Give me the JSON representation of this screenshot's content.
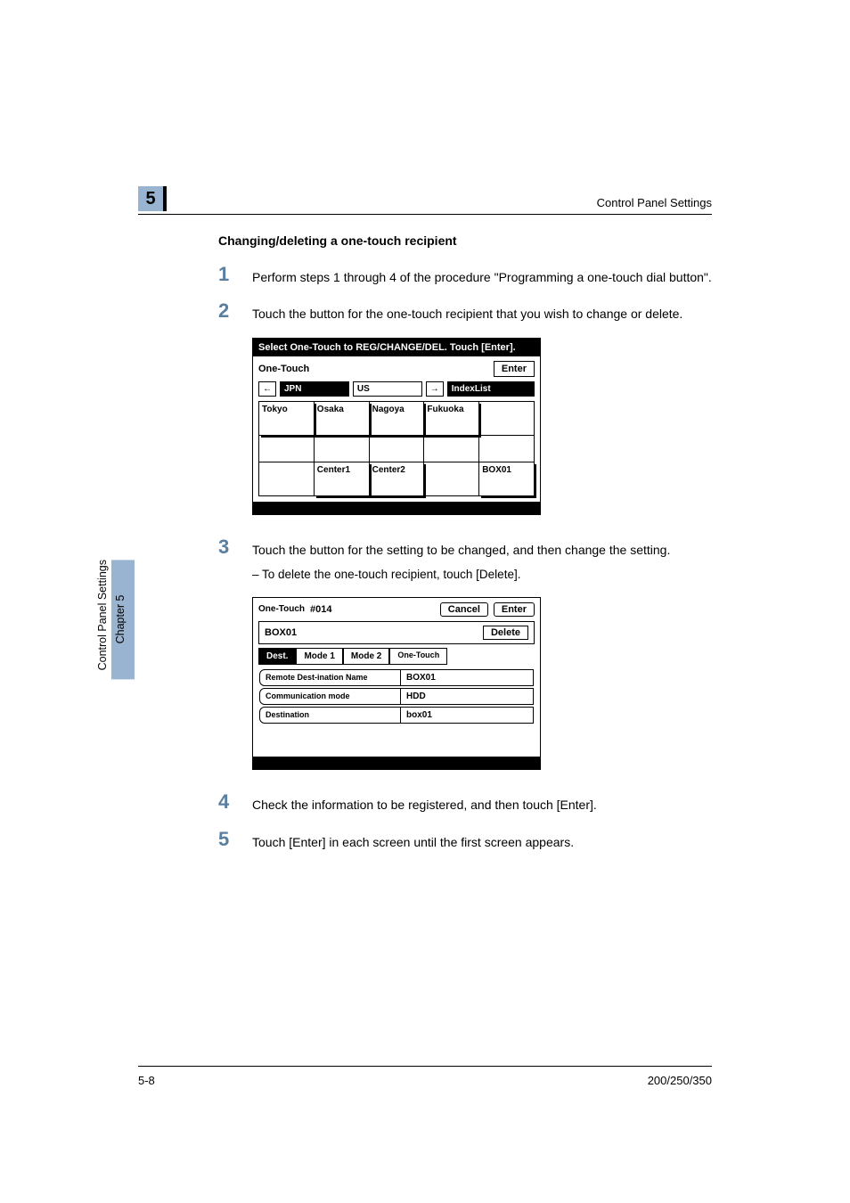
{
  "header": {
    "chapter_num": "5",
    "header_right": "Control Panel Settings"
  },
  "section_title": "Changing/deleting a one-touch recipient",
  "steps": {
    "s1": {
      "num": "1",
      "text": "Perform steps 1 through 4 of the procedure \"Programming a one-touch dial button\"."
    },
    "s2": {
      "num": "2",
      "text": "Touch the button for the one-touch recipient that you wish to change or delete."
    },
    "s3": {
      "num": "3",
      "text": "Touch the button for the setting to be changed, and then change the setting.",
      "sub": "–   To delete the one-touch recipient, touch [Delete]."
    },
    "s4": {
      "num": "4",
      "text": "Check the information to be registered, and then touch [Enter]."
    },
    "s5": {
      "num": "5",
      "text": "Touch [Enter] in each screen until the first screen appears."
    }
  },
  "panel1": {
    "instruction": "Select One-Touch to REG/CHANGE/DEL. Touch [Enter].",
    "title": "One-Touch",
    "enter": "Enter",
    "arrow_left": "←",
    "arrow_right": "→",
    "tabs": {
      "jpn": "JPN",
      "us": "US",
      "index": "IndexList"
    },
    "cells": {
      "r1c1": "Tokyo",
      "r1c2": "Osaka",
      "r1c3": "Nagoya",
      "r1c4": "Fukuoka",
      "r1c5": "",
      "r2c1": "",
      "r2c2": "",
      "r2c3": "",
      "r2c4": "",
      "r2c5": "",
      "r3c1": "",
      "r3c2": "Center1",
      "r3c3": "Center2",
      "r3c4": "",
      "r3c5": "BOX01"
    }
  },
  "panel2": {
    "title_small": "One-Touch",
    "number": "#014",
    "cancel": "Cancel",
    "enter": "Enter",
    "box": "BOX01",
    "delete": "Delete",
    "modes": {
      "dest": "Dest.",
      "m1": "Mode 1",
      "m2": "Mode 2",
      "one": "One-Touch"
    },
    "rows": {
      "r1_label": "Remote Dest-ination Name",
      "r1_val": "BOX01",
      "r2_label": "Communication mode",
      "r2_val": "HDD",
      "r3_label": "Destination",
      "r3_val": "box01"
    }
  },
  "sidetab": {
    "chapter": "Chapter 5",
    "section": "Control Panel Settings"
  },
  "footer": {
    "left": "5-8",
    "right": "200/250/350"
  }
}
